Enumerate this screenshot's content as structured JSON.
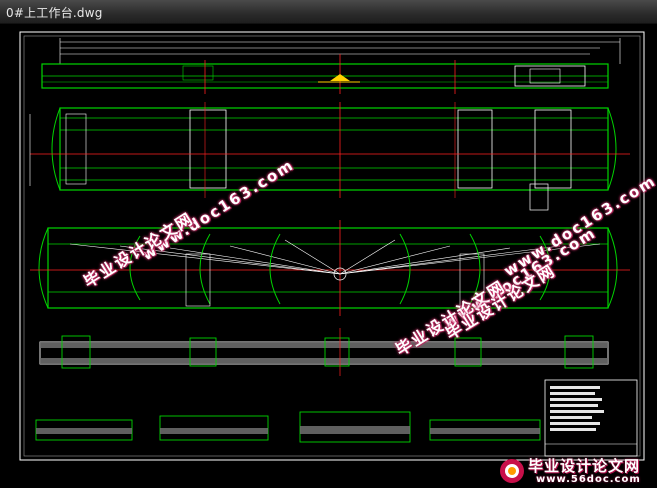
{
  "window": {
    "title": "0#上工作台.dwg"
  },
  "watermarks": [
    {
      "url": "www.doc163.com",
      "cn": "毕业设计论文网"
    },
    {
      "url": "www.doc163.com",
      "cn": "毕业设计论文网"
    },
    {
      "url": "www.doc163.com",
      "cn": "毕业设计论文网"
    }
  ],
  "logo": {
    "name": "毕业设计论文网",
    "url": "www.56doc.com"
  },
  "colors": {
    "background": "#000000",
    "green": "#00d400",
    "white": "#ffffff",
    "red": "#ff2020",
    "yellow": "#ffd000",
    "watermark_shadow": "#c8326a"
  }
}
